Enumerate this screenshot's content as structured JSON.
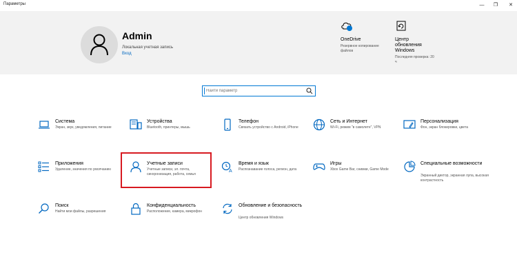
{
  "window": {
    "title": "Параметры",
    "controls": {
      "minimize": "—",
      "maximize": "❐",
      "close": "✕"
    }
  },
  "account": {
    "name": "Admin",
    "type": "Локальная учетная запись",
    "login_link": "Вход"
  },
  "header_tiles": [
    {
      "icon": "onedrive-icon",
      "title": "OneDrive",
      "desc": "Резервное копирование файлов"
    },
    {
      "icon": "windows-update-icon",
      "title": "Центр обновления Windows",
      "desc": "Последняя проверка: 20 ч"
    }
  ],
  "search": {
    "placeholder": "Найти параметр"
  },
  "categories": [
    {
      "icon": "laptop-icon",
      "name": "Система",
      "desc": "Экран, звук, уведомления, питание"
    },
    {
      "icon": "devices-icon",
      "name": "Устройства",
      "desc": "Bluetooth, принтеры, мышь"
    },
    {
      "icon": "phone-icon",
      "name": "Телефон",
      "desc": "Связать устройство с Android, iPhone"
    },
    {
      "icon": "globe-icon",
      "name": "Сеть и Интернет",
      "desc": "Wi-Fi, режим \"в самолете\", VPN"
    },
    {
      "icon": "personalization-icon",
      "name": "Персонализация",
      "desc": "Фон, экран блокировки, цвета"
    },
    {
      "icon": "apps-icon",
      "name": "Приложения",
      "desc": "Удаление, значения по умолчанию"
    },
    {
      "icon": "accounts-icon",
      "name": "Учетные записи",
      "desc": "Учетные записи, эл. почта, синхронизация, работа, семья"
    },
    {
      "icon": "time-language-icon",
      "name": "Время и язык",
      "desc": "Распознавание голоса, регион, дата"
    },
    {
      "icon": "gamepad-icon",
      "name": "Игры",
      "desc": "Xbox Game Bar, снимки, Game Mode"
    },
    {
      "icon": "accessibility-icon",
      "name": "Специальные возможности",
      "desc": "Экранный диктор, экранная лупа, высокая контрастность"
    },
    {
      "icon": "search-icon",
      "name": "Поиск",
      "desc": "Найти мои файлы, разрешения"
    },
    {
      "icon": "lock-icon",
      "name": "Конфиденциальность",
      "desc": "Расположение, камера, микрофон"
    },
    {
      "icon": "update-icon",
      "name": "Обновление и безопасность",
      "desc": "Центр обновления Windows"
    }
  ],
  "colors": {
    "accent": "#0067c0",
    "highlight": "#d71920",
    "header_bg": "#f2f2f2"
  }
}
